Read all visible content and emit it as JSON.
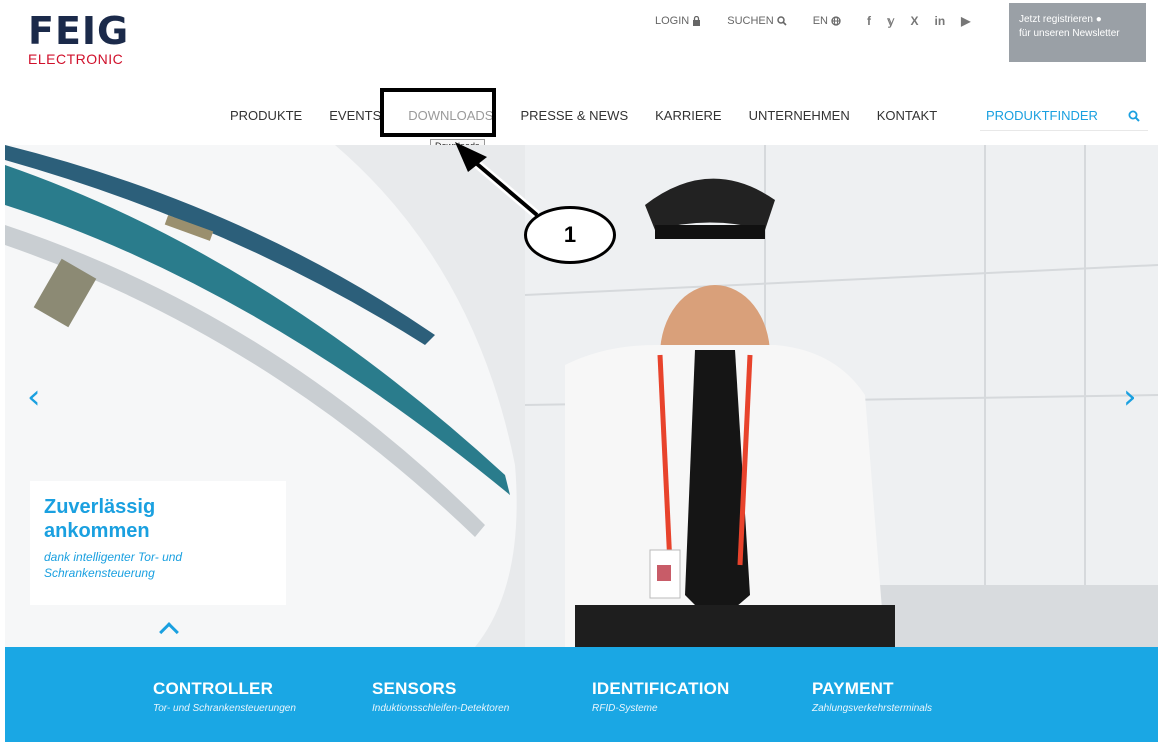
{
  "logo": {
    "name": "FEIG",
    "sub": "ELECTRONIC"
  },
  "topbar": {
    "login": "LOGIN",
    "search": "SUCHEN",
    "lang": "EN",
    "social": [
      "f",
      "𝕪",
      "X",
      "in",
      "▶"
    ]
  },
  "newsletter": {
    "line1": "Jetzt registrieren",
    "line2": "für unseren Newsletter"
  },
  "nav": {
    "items": [
      "PRODUKTE",
      "EVENTS",
      "DOWNLOADS",
      "PRESSE & NEWS",
      "KARRIERE",
      "UNTERNEHMEN",
      "KONTAKT"
    ],
    "tooltip": "Downloads"
  },
  "productfinder": {
    "placeholder": "PRODUKTFINDER"
  },
  "hero": {
    "title_line1": "Zuverlässig",
    "title_line2": "ankommen",
    "subtitle": "dank intelligenter Tor- und Schrankensteuerung"
  },
  "callout": {
    "number": "1"
  },
  "categories": [
    {
      "title": "CONTROLLER",
      "sub": "Tor- und Schrankensteuerungen"
    },
    {
      "title": "SENSORS",
      "sub": "Induktionsschleifen-Detektoren"
    },
    {
      "title": "IDENTIFICATION",
      "sub": "RFID-Systeme"
    },
    {
      "title": "PAYMENT",
      "sub": "Zahlungsverkehrsterminals"
    }
  ],
  "colors": {
    "accent": "#1aa7e4",
    "logo_dark": "#1b2a4a",
    "logo_red": "#d0102b",
    "newsletter_bg": "#9aa0a6"
  }
}
